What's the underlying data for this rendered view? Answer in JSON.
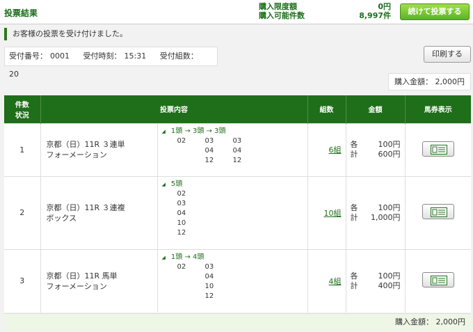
{
  "header": {
    "title": "投票結果",
    "limit_label": "購入限度額",
    "limit_value": "0円",
    "available_label": "購入可能件数",
    "available_value": "8,997件",
    "continue_label": "続けて投票する"
  },
  "notice": "お客様の投票を受け付けました。",
  "receipt": {
    "number_label": "受付番号：",
    "number_value": "0001",
    "time_label": "受付時刻：",
    "time_value": "15:31",
    "count_label": "受付組数：",
    "count_value": "20"
  },
  "print_label": "印刷する",
  "amount_top": "購入金額： 2,000円",
  "table": {
    "headers": {
      "status_line1": "件数",
      "status_line2": "状況",
      "content": "投票内容",
      "kumi": "組数",
      "amount": "金額",
      "ticket": "馬券表示"
    },
    "rows": [
      {
        "no": "1",
        "race": "京都（日）11R ３連単",
        "type": "フォーメーション",
        "selection_head": "1頭 → 3頭 → 3頭",
        "columns": [
          [
            "02"
          ],
          [
            "03",
            "04",
            "12"
          ],
          [
            "03",
            "04",
            "12"
          ]
        ],
        "kumi": "6組",
        "each_label": "各",
        "each_value": "100円",
        "total_label": "計",
        "total_value": "600円"
      },
      {
        "no": "2",
        "race": "京都（日）11R ３連複",
        "type": "ボックス",
        "selection_head": "5頭",
        "columns": [
          [
            "02",
            "03",
            "04",
            "10",
            "12"
          ]
        ],
        "kumi": "10組",
        "each_label": "各",
        "each_value": "100円",
        "total_label": "計",
        "total_value": "1,000円"
      },
      {
        "no": "3",
        "race": "京都（日）11R 馬単",
        "type": "フォーメーション",
        "selection_head": "1頭 → 4頭",
        "columns": [
          [
            "02"
          ],
          [
            "03",
            "04",
            "10",
            "12"
          ]
        ],
        "kumi": "4組",
        "each_label": "各",
        "each_value": "100円",
        "total_label": "計",
        "total_value": "400円"
      }
    ]
  },
  "amount_bottom": "購入金額： 2,000円",
  "colors": {
    "brand_green": "#1f6e1a",
    "button_green": "#5cb324"
  }
}
